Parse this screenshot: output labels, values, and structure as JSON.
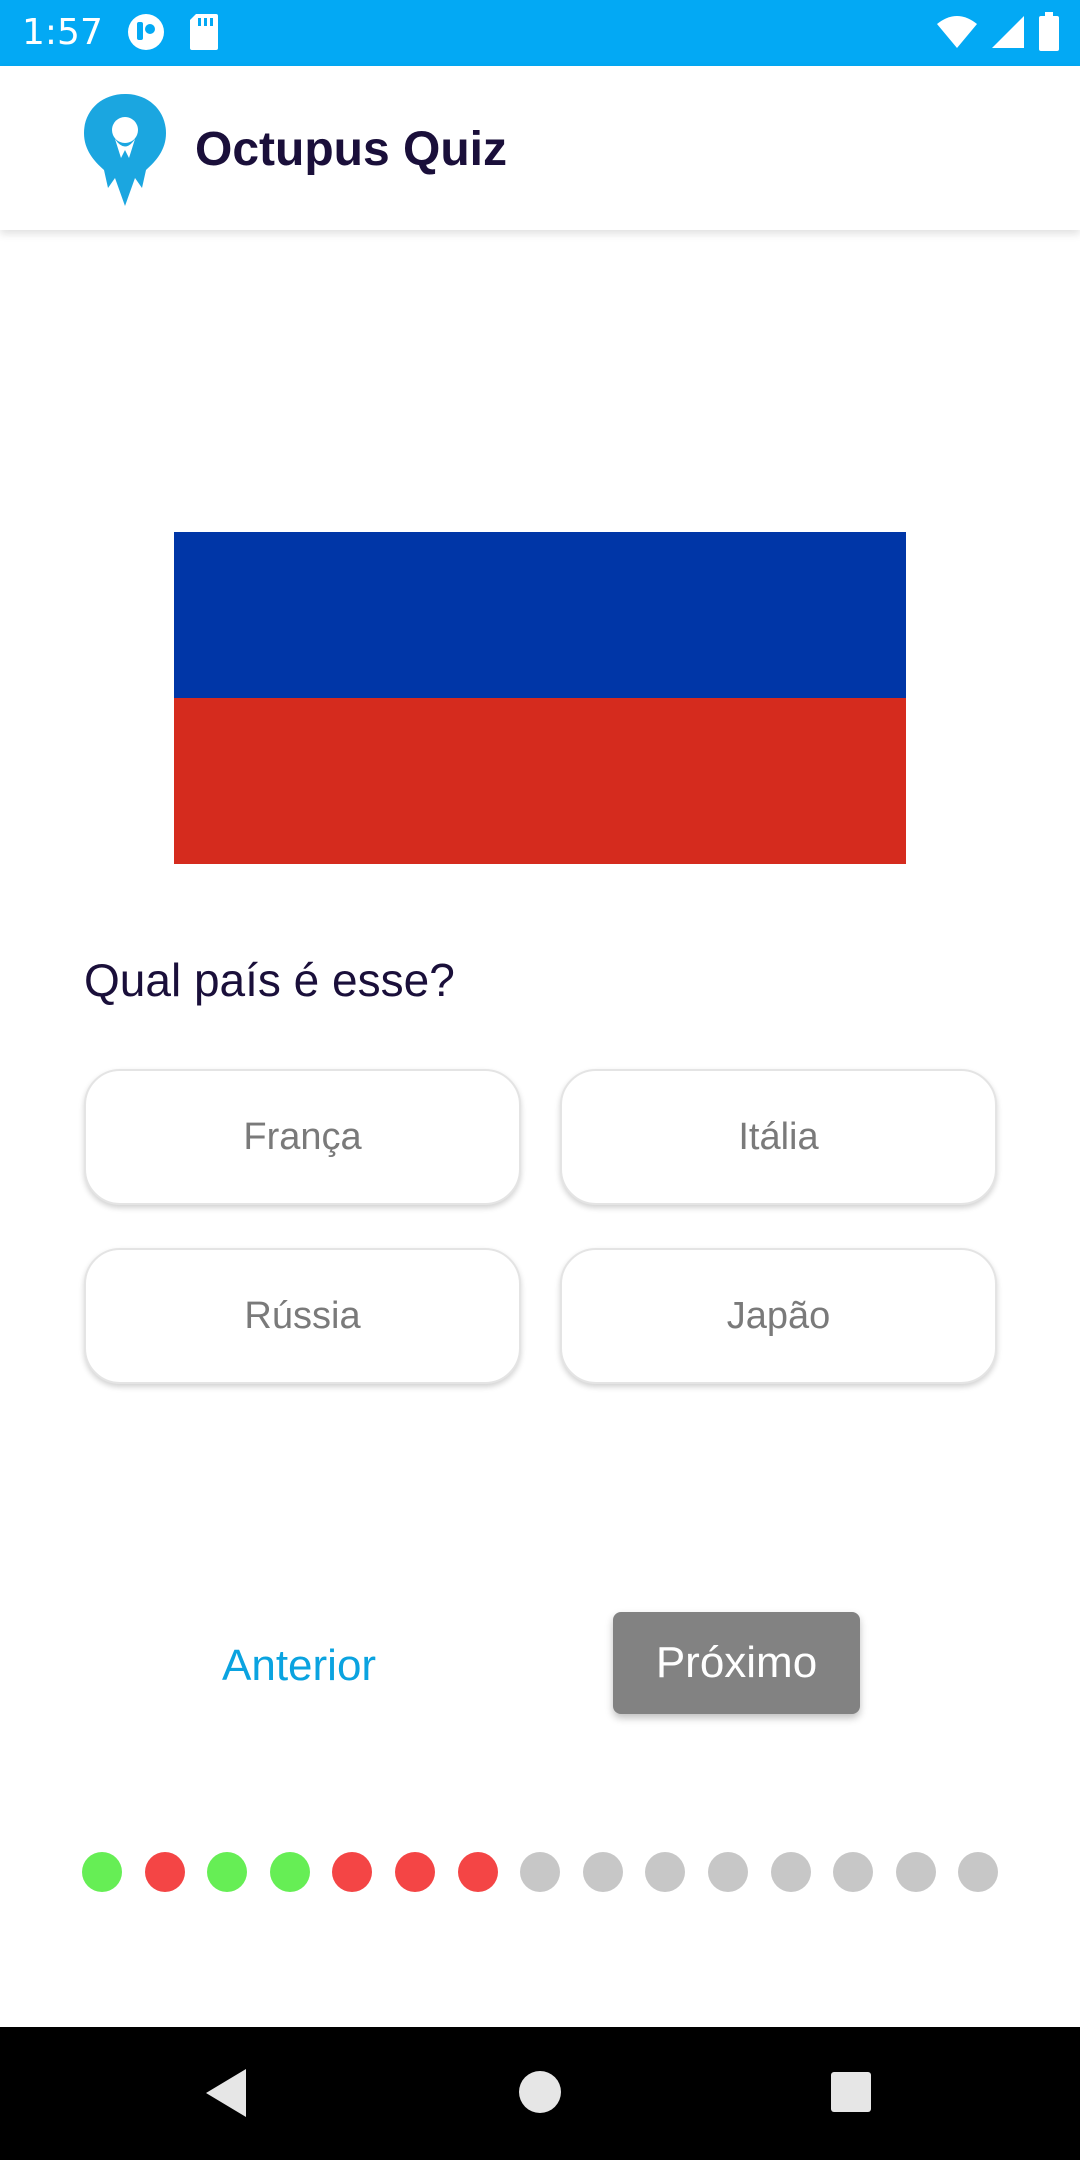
{
  "status_bar": {
    "time": "1:57",
    "left_icons": [
      "app-notification-icon",
      "sd-card-icon"
    ],
    "right_icons": [
      "wifi-icon",
      "cell-signal-icon",
      "battery-icon"
    ],
    "color": "#03a9f4"
  },
  "app_bar": {
    "title": "Octupus Quiz",
    "logo_icon": "octopus-pin-icon",
    "logo_color": "#1ba6e0"
  },
  "question": {
    "flag": {
      "stripes": [
        "#0036a7",
        "#d52b1e"
      ]
    },
    "text": "Qual país é esse?"
  },
  "answers": [
    {
      "label": "França"
    },
    {
      "label": "Itália"
    },
    {
      "label": "Rússia"
    },
    {
      "label": "Japão"
    }
  ],
  "navigation": {
    "previous_label": "Anterior",
    "next_label": "Próximo"
  },
  "progress": {
    "total": 15,
    "states": [
      "correct",
      "wrong",
      "correct",
      "correct",
      "wrong",
      "wrong",
      "wrong",
      "pending",
      "pending",
      "pending",
      "pending",
      "pending",
      "pending",
      "pending",
      "pending"
    ],
    "colors": {
      "correct": "#66ee55",
      "wrong": "#f44545",
      "pending": "#c7c7c7"
    }
  },
  "system_nav": {
    "buttons": [
      "back-icon",
      "home-icon",
      "recents-icon"
    ]
  }
}
